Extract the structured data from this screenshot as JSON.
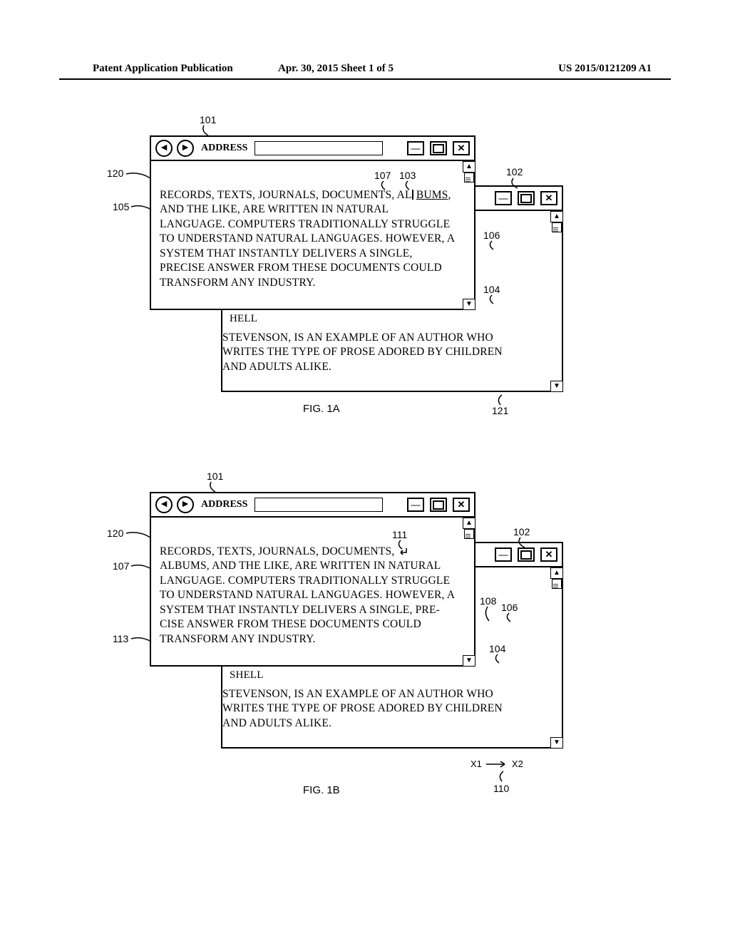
{
  "header": {
    "left": "Patent Application Publication",
    "mid": "Apr. 30, 2015   Sheet 1 of 5",
    "right": "US 2015/0121209 A1"
  },
  "window": {
    "address_label": "ADDRESS",
    "btn_min": "—",
    "btn_close": "✕",
    "nav_back": "◄",
    "nav_fwd": "►"
  },
  "figA": {
    "caption": "FIG. 1A",
    "main_text_l1": "RECORDS, TEXTS, JOURNALS, DOCUMENTS, AL",
    "main_text_underlined": "BUMS",
    "main_text_rest": ", AND THE LIKE, ARE WRITTEN IN NATURAL LANGUAGE. COMPUTERS TRADITIONALLY STRUGGLE TO UNDERSTAND NATURAL LANGUAGES. HOWEVER, A SYSTEM THAT INSTANTLY DELIVERS A SINGLE, PRECISE ANSWER FROM THESE DOCUMENTS COULD TRANSFORM ANY INDUSTRY.",
    "back_text": "STEVENSON, IS AN EXAMPLE OF AN AUTHOR WHO WRITES THE TYPE OF PROSE ADORED BY CHILDREN AND ADULTS ALIKE.",
    "small_word1": "ELL",
    "small_word2": "HELL",
    "refs": {
      "r101": "101",
      "r102": "102",
      "r103": "103",
      "r104": "104",
      "r105": "105",
      "r106": "106",
      "r107": "107",
      "r120": "120",
      "r121": "121"
    }
  },
  "figB": {
    "caption": "FIG. 1B",
    "main_text_l1": "RECORDS, TEXTS, JOURNALS, DOCUMENTS,",
    "main_text_l2": "ALBUMS, AND THE LIKE, ARE WRITTEN IN NATURAL LANGUAGE. COMPUTERS TRADITIONALLY STRUGGLE TO UNDERSTAND NATURAL LANGUAGES. HOWEVER, A SYSTEM THAT INSTANTLY DELIVERS A SINGLE, PRE-",
    "main_text_l3": "CISE ANSWER FROM THESE DOCUMENTS COULD TRANSFORM ANY INDUSTRY.",
    "back_text": "STEVENSON, IS AN EXAMPLE OF AN AUTHOR WHO WRITES THE TYPE OF PROSE ADORED BY CHILDREN AND ADULTS ALIKE.",
    "small_word1": "*ELL",
    "small_word2": "SHELL",
    "axis": {
      "x1": "X1",
      "x2": "X2"
    },
    "refs": {
      "r101": "101",
      "r102": "102",
      "r104": "104",
      "r106": "106",
      "r107": "107",
      "r108": "108",
      "r110": "110",
      "r111": "111",
      "r113": "113",
      "r120": "120"
    }
  }
}
